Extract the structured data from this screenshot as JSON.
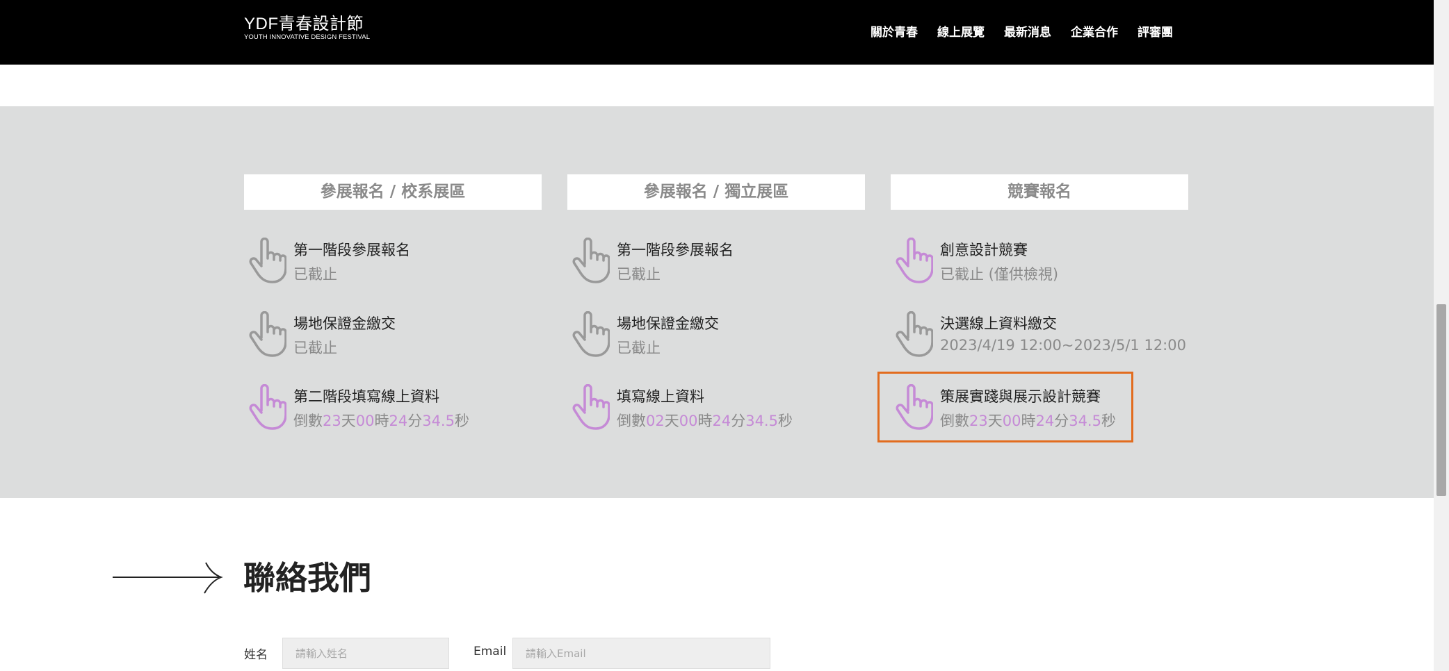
{
  "header": {
    "logo_main": "YDF青春設計節",
    "logo_sub": "YOUTH INNOVATIVE DESIGN FESTIVAL",
    "nav": [
      "關於青春",
      "線上展覽",
      "最新消息",
      "企業合作",
      "評審團"
    ]
  },
  "columns": [
    {
      "header": "參展報名 / 校系展區",
      "items": [
        {
          "title": "第一階段參展報名",
          "status": "已截止",
          "icon": "hand-pointer-icon",
          "icon_color": "#999999"
        },
        {
          "title": "場地保證金繳交",
          "status": "已截止",
          "icon": "hand-pointer-icon",
          "icon_color": "#999999"
        },
        {
          "title": "第二階段填寫線上資料",
          "icon": "hand-pointer-icon",
          "icon_color": "#c58ad6",
          "countdown": {
            "prefix": "倒數",
            "days": "23",
            "days_unit": "天",
            "hours": "00",
            "hours_unit": "時",
            "minutes": "24",
            "minutes_unit": "分",
            "seconds": "34.5",
            "seconds_unit": "秒"
          }
        }
      ]
    },
    {
      "header": "參展報名 / 獨立展區",
      "items": [
        {
          "title": "第一階段參展報名",
          "status": "已截止",
          "icon": "hand-pointer-icon",
          "icon_color": "#999999"
        },
        {
          "title": "場地保證金繳交",
          "status": "已截止",
          "icon": "hand-pointer-icon",
          "icon_color": "#999999"
        },
        {
          "title": "填寫線上資料",
          "icon": "hand-pointer-icon",
          "icon_color": "#c58ad6",
          "countdown": {
            "prefix": "倒數",
            "days": "02",
            "days_unit": "天",
            "hours": "00",
            "hours_unit": "時",
            "minutes": "24",
            "minutes_unit": "分",
            "seconds": "34.5",
            "seconds_unit": "秒"
          }
        }
      ]
    },
    {
      "header": "競賽報名",
      "items": [
        {
          "title": "創意設計競賽",
          "status": "已截止 (僅供檢視)",
          "icon": "hand-pointer-icon",
          "icon_color": "#c58ad6"
        },
        {
          "title": "決選線上資料繳交",
          "status": "2023/4/19 12:00~2023/5/1 12:00",
          "icon": "hand-pointer-icon",
          "icon_color": "#999999"
        },
        {
          "title": "策展實踐與展示設計競賽",
          "icon": "hand-pointer-icon",
          "icon_color": "#c58ad6",
          "highlighted": true,
          "countdown": {
            "prefix": "倒數",
            "days": "23",
            "days_unit": "天",
            "hours": "00",
            "hours_unit": "時",
            "minutes": "24",
            "minutes_unit": "分",
            "seconds": "34.5",
            "seconds_unit": "秒"
          }
        }
      ]
    }
  ],
  "contact": {
    "title": "聯絡我們",
    "name_label": "姓名",
    "name_placeholder": "請輸入姓名",
    "email_label": "Email",
    "email_placeholder": "請輸入Email"
  },
  "colors": {
    "accent_purple": "#c58ad6",
    "muted_gray": "#8a8a8a",
    "highlight_orange": "#e26c1e",
    "section_bg": "#dcdddd"
  }
}
